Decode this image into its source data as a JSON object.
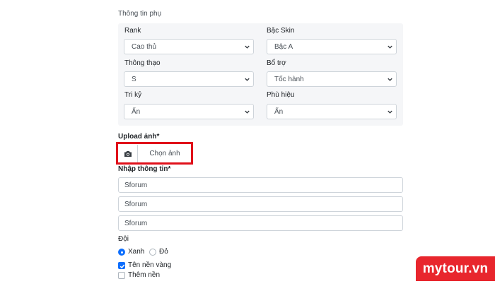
{
  "section_title": "Thông tin phụ",
  "fields": {
    "rank": {
      "label": "Rank",
      "value": "Cao thủ"
    },
    "skin": {
      "label": "Bậc Skin",
      "value": "Bậc A"
    },
    "proficiency": {
      "label": "Thông thạo",
      "value": "S"
    },
    "support": {
      "label": "Bổ trợ",
      "value": "Tốc hành"
    },
    "soulmate": {
      "label": "Tri kỷ",
      "value": "Ẩn"
    },
    "badge": {
      "label": "Phù hiệu",
      "value": "Ẩn"
    }
  },
  "upload": {
    "label": "Upload ảnh*",
    "button": "Chọn ảnh",
    "icon": "camera-icon",
    "highlight_color": "#e0101a"
  },
  "info": {
    "label": "Nhập thông tin*",
    "inputs": [
      "Sforum",
      "Sforum",
      "Sforum"
    ]
  },
  "team": {
    "label": "Đội",
    "options": [
      {
        "label": "Xanh",
        "selected": true
      },
      {
        "label": "Đỏ",
        "selected": false
      }
    ]
  },
  "checks": [
    {
      "label": "Tên nền vàng",
      "checked": true
    },
    {
      "label": "Thêm nền",
      "checked": false
    }
  ],
  "brand": {
    "logo_text": "mytour.vn",
    "color": "#e8262d"
  },
  "accent": "#0d6efd"
}
